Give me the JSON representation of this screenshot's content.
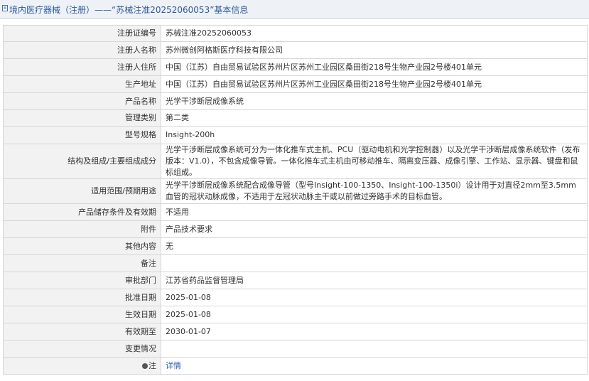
{
  "header": {
    "title": "境内医疗器械（注册）——“苏械注准20252060053”基本信息",
    "icon": "document-icon"
  },
  "rows": [
    {
      "label": "注册证编号",
      "value": "苏械注准20252060053"
    },
    {
      "label": "注册人名称",
      "value": "苏州微创阿格斯医疗科技有限公司"
    },
    {
      "label": "注册人住所",
      "value": "中国（江苏）自由贸易试验区苏州片区苏州工业园区桑田街218号生物产业园2号楼401单元"
    },
    {
      "label": "生产地址",
      "value": "中国（江苏）自由贸易试验区苏州片区苏州工业园区桑田街218号生物产业园2号楼401单元"
    },
    {
      "label": "产品名称",
      "value": "光学干涉断层成像系统"
    },
    {
      "label": "管理类别",
      "value": "第二类"
    },
    {
      "label": "型号规格",
      "value": "Insight-200h"
    },
    {
      "label": "结构及组成/主要组成成分",
      "value": "光学干涉断层成像系统可分为一体化推车式主机、PCU（驱动电机和光学控制器）以及光学干涉断层成像系统软件（发布版本：V1.0），不包含成像导管。一体化推车式主机由可移动推车、隔离变压器、成像引擎、工作站、显示器、键盘和鼠标组成。"
    },
    {
      "label": "适用范围/预期用途",
      "value": "光学干涉断层成像系统配合成像导管（型号Insight-100-1350、Insight-100-1350i）设计用于对直径2mm至3.5mm血管的冠状动脉成像，不适用于左冠状动脉主干或以前做过旁路手术的目标血管。"
    },
    {
      "label": "产品储存条件及有效期",
      "value": "不适用"
    },
    {
      "label": "附件",
      "value": "产品技术要求"
    },
    {
      "label": "其他内容",
      "value": "无"
    },
    {
      "label": "备注",
      "value": ""
    },
    {
      "label": "审批部门",
      "value": "江苏省药品监督管理局"
    },
    {
      "label": "批准日期",
      "value": "2025-01-08"
    },
    {
      "label": "生效日期",
      "value": "2025-01-08"
    },
    {
      "label": "有效期至",
      "value": "2030-01-07"
    },
    {
      "label": "变更情况",
      "value": ""
    },
    {
      "label": "注",
      "value": "详情",
      "icon": "note-icon"
    }
  ]
}
